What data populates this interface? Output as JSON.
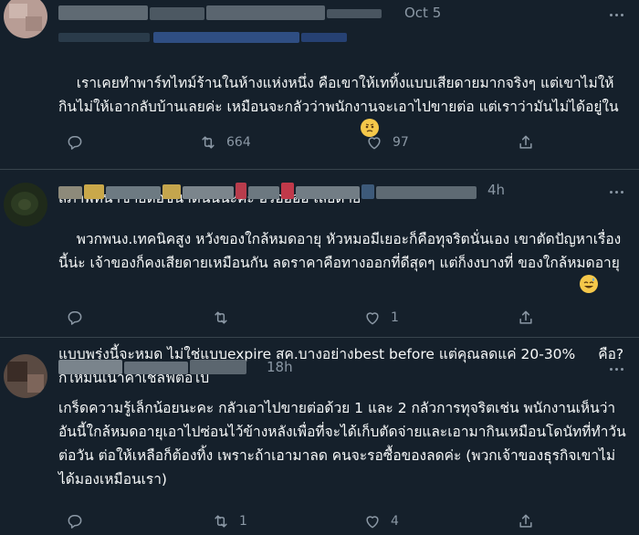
{
  "tweets": [
    {
      "time": "Oct 5",
      "text": "เราเคยทำพาร์ทไทม์ร้านในห้างแห่งหนึ่ง คือเขาให้เททิ้งแบบเสียดายมากจริงๆ แต่เขาไม่ให้กินไม่ให้เอากลับบ้านเลยค่ะ เหมือนจะกลัวว่าพนักงานจะเอาไปขายต่อ แต่เราว่ามันไม่ได้อยู่ในสภาพที่น่าขายต่อขนาดนั้นนะคะ ฮรืออออ เสียดาย",
      "emoji": "worried-face-emoji",
      "reply_count": "",
      "retweet_count": "664",
      "like_count": "97"
    },
    {
      "time": "4h",
      "text_a": "พวกพนง.เทคนิคสูง หวังของใกล้หมดอายุ หัวหมอมีเยอะก็คือทุจริตนั่นเอง เขาตัดปัญหาเรื่องนี้น่ะ เจ้าของก็คงเสียดายเหมือนกัน ลดราคาคือทางออกที่ดีสุดๆ แต่ก็งงบางที่ ของใกล้หมดอายุแบบพรุ่งนี้จะหมด ไม่ใช่แบบexpire สค.บางอย่างbest before แต่คุณลดแค่ 20-30% ",
      "text_b": "คือ? ก็ให้มันเน่าค่าเชลฟ์ต่อไป",
      "emoji": "sweat-smile-emoji",
      "reply_count": "",
      "retweet_count": "",
      "like_count": "1"
    },
    {
      "time": "18h",
      "text": "เกร็ดความรู้เล็กน้อยนะคะ กลัวเอาไปขายต่อด้วย 1 และ 2 กลัวการทุจริตเช่น พนักงานเห็นว่าอันนี้ใกล้หมดอายุเอาไปซ่อนไว้ข้างหลังเพื่อที่จะได้เก็บตัดจ่ายและเอามากินเหมือนโดนัทที่ทำวันต่อวัน ต่อให้เหลือก็ต้องทิ้ง เพราะถ้าเอามาลด คนจะรอซื้อของลดค่ะ (พวกเจ้าของธุรกิจเขาไม่ได้มองเหมือนเรา)",
      "reply_count": "",
      "retweet_count": "1",
      "like_count": "4"
    }
  ],
  "icons": {
    "reply": "reply-icon",
    "retweet": "retweet-icon",
    "like": "like-icon",
    "share": "share-icon",
    "more": "more-icon"
  },
  "colors": {
    "background": "#15202b",
    "text": "#f7f9f9",
    "muted": "#8b98a5",
    "divider": "#38444d"
  }
}
